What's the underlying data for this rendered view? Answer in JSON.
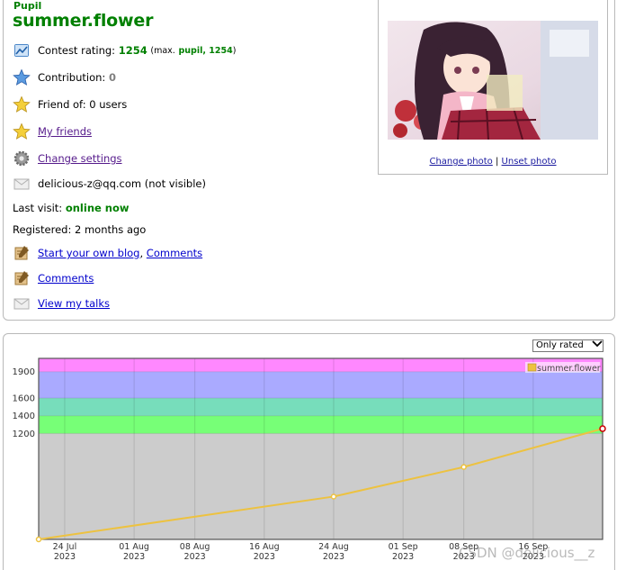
{
  "profile": {
    "rank": "Pupil",
    "handle": "summer.flower",
    "rating_label": "Contest rating:",
    "rating_value": "1254",
    "rating_max_open": "(max.",
    "rating_max_rank": "pupil, 1254",
    "rating_max_close": ")",
    "contribution_label": "Contribution:",
    "contribution_value": "0",
    "friend_of": "Friend of: 0 users",
    "my_friends": "My friends",
    "change_settings": "Change settings",
    "email": "delicious-z@qq.com (not visible)",
    "last_visit_label": "Last visit:",
    "last_visit_value": "online now",
    "registered": "Registered: 2 months ago",
    "blog_link": "Start your own blog",
    "blog_sep": ",",
    "blog_comments": "Comments",
    "comments": "Comments",
    "talks": "View my talks"
  },
  "photo": {
    "change": "Change photo",
    "sep": "|",
    "unset": "Unset photo"
  },
  "chart_controls": {
    "select_value": "Only rated"
  },
  "watermark": "CSDN @delicious__z",
  "icons": {
    "rating": "rating-chart-icon",
    "contribution": "blue-star-icon",
    "friend_of": "star-icon",
    "my_friends": "star-icon",
    "settings": "gear-icon",
    "email": "envelope-icon",
    "blog": "blog-icon",
    "comments": "comments-icon",
    "talks": "envelope-icon"
  },
  "chart_data": {
    "type": "line",
    "series": [
      {
        "name": "summer.flower",
        "color": "#edc240",
        "x": [
          "2023-07-21",
          "2023-08-24",
          "2023-09-08",
          "2023-09-24"
        ],
        "y": [
          0,
          485,
          820,
          1254
        ]
      }
    ],
    "x_ticks": [
      {
        "day": "24 Jul",
        "year": "2023",
        "date": "2023-07-24"
      },
      {
        "day": "01 Aug",
        "year": "2023",
        "date": "2023-08-01"
      },
      {
        "day": "08 Aug",
        "year": "2023",
        "date": "2023-08-08"
      },
      {
        "day": "16 Aug",
        "year": "2023",
        "date": "2023-08-16"
      },
      {
        "day": "24 Aug",
        "year": "2023",
        "date": "2023-08-24"
      },
      {
        "day": "01 Sep",
        "year": "2023",
        "date": "2023-09-01"
      },
      {
        "day": "08 Sep",
        "year": "2023",
        "date": "2023-09-08"
      },
      {
        "day": "16 Sep",
        "year": "2023",
        "date": "2023-09-16"
      }
    ],
    "y_ticks": [
      "1200",
      "1400",
      "1600",
      "1900"
    ],
    "ylim": [
      0,
      2050
    ],
    "xlim": [
      "2023-07-21",
      "2023-09-24"
    ],
    "bands": [
      {
        "from": 0,
        "to": 1200,
        "color": "#cccccc"
      },
      {
        "from": 1200,
        "to": 1400,
        "color": "#77ff77"
      },
      {
        "from": 1400,
        "to": 1600,
        "color": "#77ddbb"
      },
      {
        "from": 1600,
        "to": 1900,
        "color": "#aaaaff"
      },
      {
        "from": 1900,
        "to": 2050,
        "color": "#ff88ff"
      }
    ],
    "grid": true,
    "legend": "top-right"
  }
}
